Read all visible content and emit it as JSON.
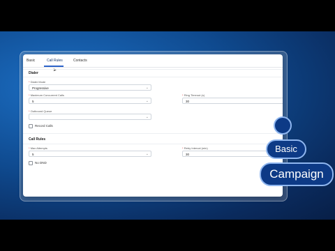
{
  "tabs": [
    {
      "label": "Basic"
    },
    {
      "label": "Call Rules"
    },
    {
      "label": "Contacts"
    }
  ],
  "active_tab_index": 1,
  "dialer": {
    "title": "Dialer",
    "dialer_mode": {
      "label": "Dialer Mode",
      "value": "Progressive"
    },
    "max_concurrent_calls": {
      "label": "Maximum Concurrent Calls",
      "value": "5"
    },
    "ring_timeout": {
      "label": "Ring Timeout (s)",
      "value": "30"
    },
    "outbound_queue": {
      "label": "Outbound Queue",
      "value": ""
    },
    "record_calls": {
      "label": "Record Calls",
      "checked": false
    }
  },
  "call_rules": {
    "title": "Call Rules",
    "max_attempts": {
      "label": "Max Attempts",
      "value": "5"
    },
    "retry_interval": {
      "label": "Retry Interval (min)",
      "value": "30"
    },
    "no_dnd": {
      "label": "No DND",
      "checked": false
    }
  },
  "bubbles": {
    "basic": "Basic",
    "campaign": "Campaign"
  },
  "colors": {
    "accent": "#2b63c9",
    "bubble_fill": "#0d3a86",
    "bubble_border": "#8fb6ef"
  },
  "icons": [
    "chevron-down-icon",
    "mouse-pointer-icon"
  ]
}
